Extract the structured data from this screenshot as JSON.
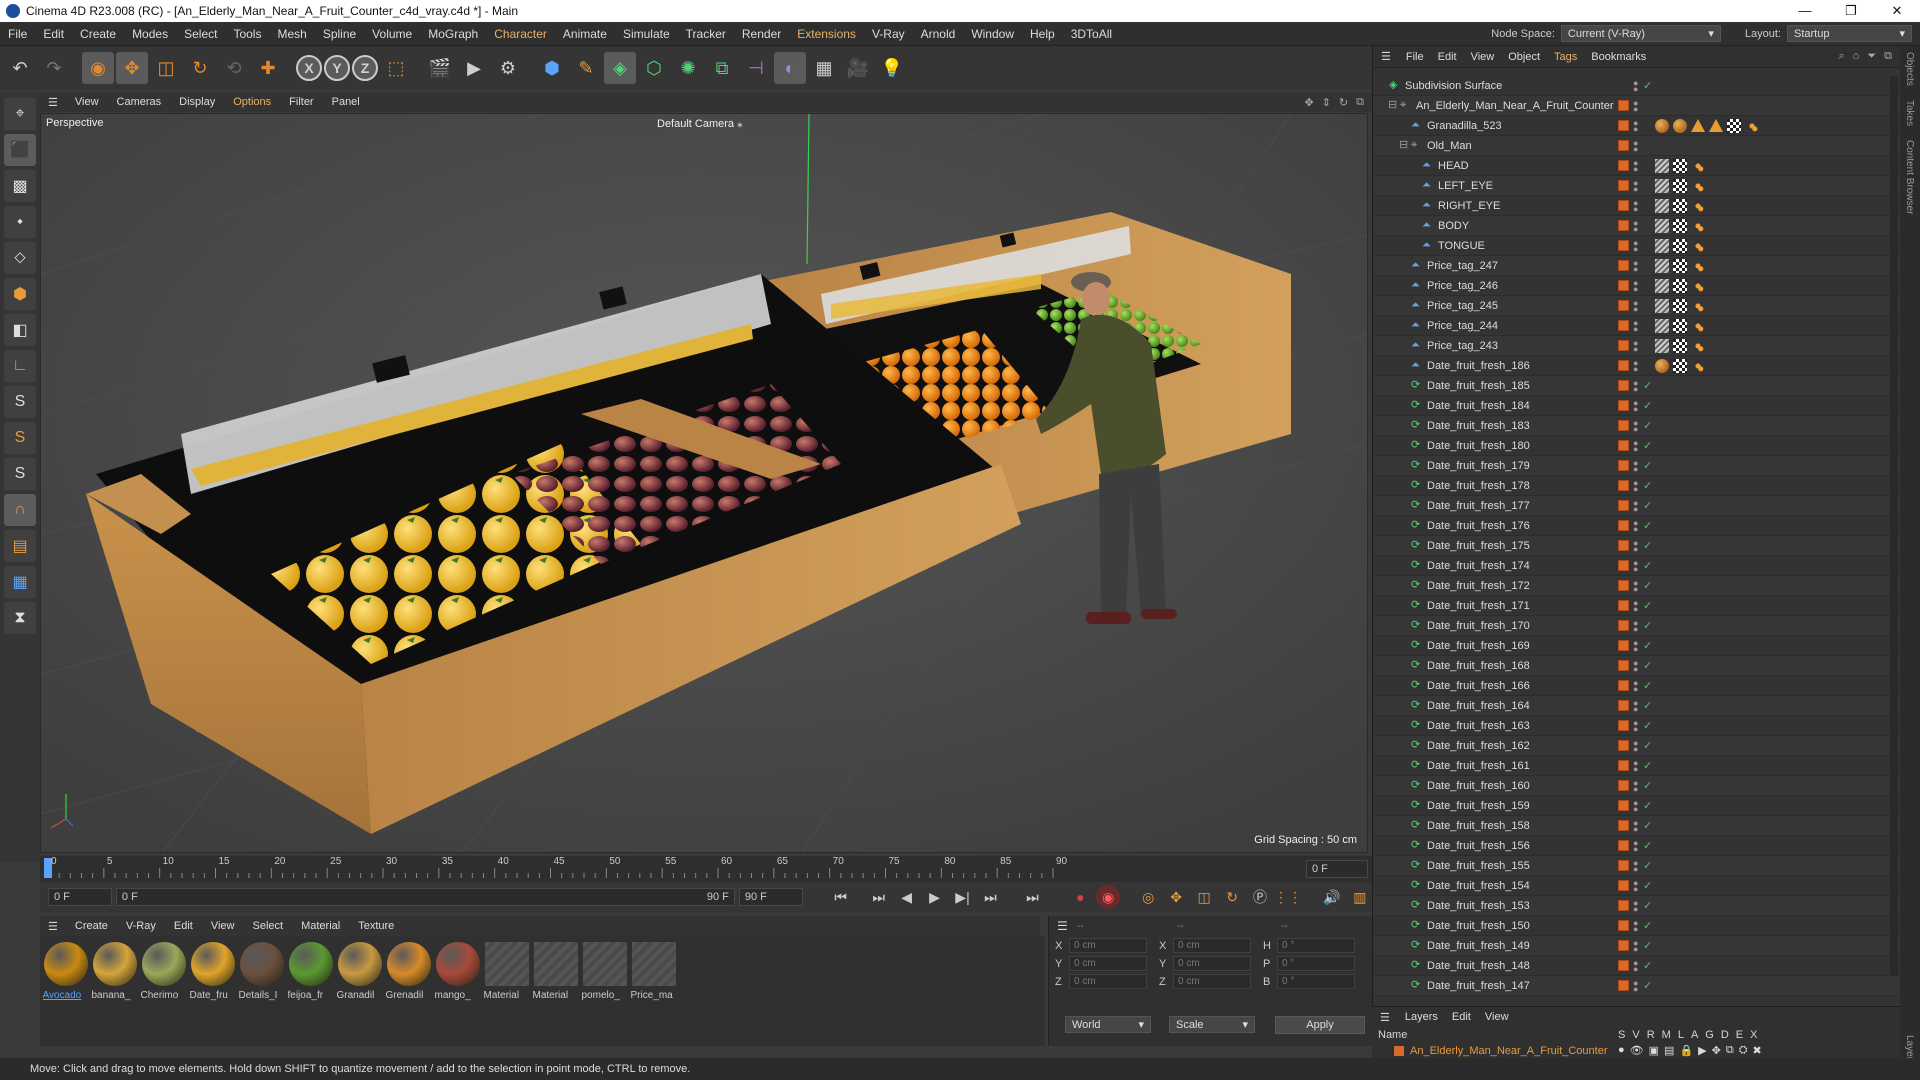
{
  "window": {
    "title": "Cinema 4D R23.008 (RC) - [An_Elderly_Man_Near_A_Fruit_Counter_c4d_vray.c4d *] - Main"
  },
  "menu": [
    "File",
    "Edit",
    "Create",
    "Modes",
    "Select",
    "Tools",
    "Mesh",
    "Spline",
    "Volume",
    "MoGraph",
    "Character",
    "Animate",
    "Simulate",
    "Tracker",
    "Render",
    "Extensions",
    "V-Ray",
    "Arnold",
    "Window",
    "Help",
    "3DToAll"
  ],
  "menu_highlight": [
    "Character",
    "Extensions"
  ],
  "nodespace": {
    "label": "Node Space:",
    "value": "Current (V-Ray)"
  },
  "layout": {
    "label": "Layout:",
    "value": "Startup"
  },
  "toolbar_axes": [
    "X",
    "Y",
    "Z"
  ],
  "left_tools": [
    "S",
    "S",
    "S"
  ],
  "viewport_menu": [
    "View",
    "Cameras",
    "Display",
    "Options",
    "Filter",
    "Panel"
  ],
  "viewport": {
    "label": "Perspective",
    "camera": "Default Camera",
    "grid": "Grid Spacing : 50 cm"
  },
  "timeline": {
    "ticks": [
      "0",
      "5",
      "10",
      "15",
      "20",
      "25",
      "30",
      "35",
      "40",
      "45",
      "50",
      "55",
      "60",
      "65",
      "70",
      "75",
      "80",
      "85",
      "90"
    ],
    "frame_field": "0 F"
  },
  "transport": {
    "start": "0 F",
    "cur": "0 F",
    "end": "90 F",
    "end2": "90 F"
  },
  "material_menu": [
    "Create",
    "V-Ray",
    "Edit",
    "View",
    "Select",
    "Material",
    "Texture"
  ],
  "materials": [
    {
      "name": "Avocado",
      "color": "#c98a12",
      "selected": true
    },
    {
      "name": "banana_",
      "color": "#d4a53a",
      "selected": false
    },
    {
      "name": "Cherimo",
      "color": "#9aa85a",
      "selected": false
    },
    {
      "name": "Date_fru",
      "color": "#e0a52a",
      "selected": false
    },
    {
      "name": "Details_I",
      "color": "#6a5040",
      "selected": false
    },
    {
      "name": "feijoa_fr",
      "color": "#5a9a32",
      "selected": false
    },
    {
      "name": "Granadil",
      "color": "#c89a40",
      "selected": false
    },
    {
      "name": "Grenadil",
      "color": "#d88a2a",
      "selected": false
    },
    {
      "name": "mango_",
      "color": "#a84a3a",
      "selected": false
    },
    {
      "name": "Material",
      "color": "",
      "selected": false
    },
    {
      "name": "Material",
      "color": "",
      "selected": false
    },
    {
      "name": "pomelo_",
      "color": "",
      "selected": false
    },
    {
      "name": "Price_ma",
      "color": "",
      "selected": false
    }
  ],
  "coords": {
    "header": "--",
    "rows": [
      {
        "a": "X",
        "v1": "0 cm",
        "b": "X",
        "v2": "0 cm",
        "c": "H",
        "v3": "0 °"
      },
      {
        "a": "Y",
        "v1": "0 cm",
        "b": "Y",
        "v2": "0 cm",
        "c": "P",
        "v3": "0 °"
      },
      {
        "a": "Z",
        "v1": "0 cm",
        "b": "Z",
        "v2": "0 cm",
        "c": "B",
        "v3": "0 °"
      }
    ],
    "world": "World",
    "scale": "Scale",
    "apply": "Apply"
  },
  "status": "Move: Click and drag to move elements. Hold down SHIFT to quantize movement / add to the selection in point mode, CTRL to remove.",
  "objects_menu": [
    "File",
    "Edit",
    "View",
    "Object",
    "Tags",
    "Bookmarks"
  ],
  "objects": [
    {
      "name": "Subdivision Surface",
      "indent": 0,
      "kind": "subd",
      "tags": []
    },
    {
      "name": "An_Elderly_Man_Near_A_Fruit_Counter",
      "indent": 1,
      "kind": "null",
      "tags": []
    },
    {
      "name": "Granadilla_523",
      "indent": 2,
      "kind": "bone",
      "tags": [
        "b",
        "b",
        "t",
        "t",
        "c",
        "o"
      ]
    },
    {
      "name": "Old_Man",
      "indent": 2,
      "kind": "null",
      "tags": []
    },
    {
      "name": "HEAD",
      "indent": 3,
      "kind": "bone",
      "tags": [
        "g",
        "c",
        "o"
      ]
    },
    {
      "name": "LEFT_EYE",
      "indent": 3,
      "kind": "bone",
      "tags": [
        "g",
        "c",
        "o"
      ]
    },
    {
      "name": "RIGHT_EYE",
      "indent": 3,
      "kind": "bone",
      "tags": [
        "g",
        "c",
        "o"
      ]
    },
    {
      "name": "BODY",
      "indent": 3,
      "kind": "bone",
      "tags": [
        "g",
        "c",
        "o"
      ]
    },
    {
      "name": "TONGUE",
      "indent": 3,
      "kind": "bone",
      "tags": [
        "g",
        "c",
        "o"
      ]
    },
    {
      "name": "Price_tag_247",
      "indent": 2,
      "kind": "bone",
      "tags": [
        "g",
        "c",
        "o"
      ]
    },
    {
      "name": "Price_tag_246",
      "indent": 2,
      "kind": "bone",
      "tags": [
        "g",
        "c",
        "o"
      ]
    },
    {
      "name": "Price_tag_245",
      "indent": 2,
      "kind": "bone",
      "tags": [
        "g",
        "c",
        "o"
      ]
    },
    {
      "name": "Price_tag_244",
      "indent": 2,
      "kind": "bone",
      "tags": [
        "g",
        "c",
        "o"
      ]
    },
    {
      "name": "Price_tag_243",
      "indent": 2,
      "kind": "bone",
      "tags": [
        "g",
        "c",
        "o"
      ]
    },
    {
      "name": "Date_fruit_fresh_186",
      "indent": 2,
      "kind": "bone",
      "tags": [
        "b",
        "c",
        "o"
      ]
    },
    {
      "name": "Date_fruit_fresh_185",
      "indent": 2,
      "kind": "inst",
      "tags": []
    },
    {
      "name": "Date_fruit_fresh_184",
      "indent": 2,
      "kind": "inst",
      "tags": []
    },
    {
      "name": "Date_fruit_fresh_183",
      "indent": 2,
      "kind": "inst",
      "tags": []
    },
    {
      "name": "Date_fruit_fresh_180",
      "indent": 2,
      "kind": "inst",
      "tags": []
    },
    {
      "name": "Date_fruit_fresh_179",
      "indent": 2,
      "kind": "inst",
      "tags": []
    },
    {
      "name": "Date_fruit_fresh_178",
      "indent": 2,
      "kind": "inst",
      "tags": []
    },
    {
      "name": "Date_fruit_fresh_177",
      "indent": 2,
      "kind": "inst",
      "tags": []
    },
    {
      "name": "Date_fruit_fresh_176",
      "indent": 2,
      "kind": "inst",
      "tags": []
    },
    {
      "name": "Date_fruit_fresh_175",
      "indent": 2,
      "kind": "inst",
      "tags": []
    },
    {
      "name": "Date_fruit_fresh_174",
      "indent": 2,
      "kind": "inst",
      "tags": []
    },
    {
      "name": "Date_fruit_fresh_172",
      "indent": 2,
      "kind": "inst",
      "tags": []
    },
    {
      "name": "Date_fruit_fresh_171",
      "indent": 2,
      "kind": "inst",
      "tags": []
    },
    {
      "name": "Date_fruit_fresh_170",
      "indent": 2,
      "kind": "inst",
      "tags": []
    },
    {
      "name": "Date_fruit_fresh_169",
      "indent": 2,
      "kind": "inst",
      "tags": []
    },
    {
      "name": "Date_fruit_fresh_168",
      "indent": 2,
      "kind": "inst",
      "tags": []
    },
    {
      "name": "Date_fruit_fresh_166",
      "indent": 2,
      "kind": "inst",
      "tags": []
    },
    {
      "name": "Date_fruit_fresh_164",
      "indent": 2,
      "kind": "inst",
      "tags": []
    },
    {
      "name": "Date_fruit_fresh_163",
      "indent": 2,
      "kind": "inst",
      "tags": []
    },
    {
      "name": "Date_fruit_fresh_162",
      "indent": 2,
      "kind": "inst",
      "tags": []
    },
    {
      "name": "Date_fruit_fresh_161",
      "indent": 2,
      "kind": "inst",
      "tags": []
    },
    {
      "name": "Date_fruit_fresh_160",
      "indent": 2,
      "kind": "inst",
      "tags": []
    },
    {
      "name": "Date_fruit_fresh_159",
      "indent": 2,
      "kind": "inst",
      "tags": []
    },
    {
      "name": "Date_fruit_fresh_158",
      "indent": 2,
      "kind": "inst",
      "tags": []
    },
    {
      "name": "Date_fruit_fresh_156",
      "indent": 2,
      "kind": "inst",
      "tags": []
    },
    {
      "name": "Date_fruit_fresh_155",
      "indent": 2,
      "kind": "inst",
      "tags": []
    },
    {
      "name": "Date_fruit_fresh_154",
      "indent": 2,
      "kind": "inst",
      "tags": []
    },
    {
      "name": "Date_fruit_fresh_153",
      "indent": 2,
      "kind": "inst",
      "tags": []
    },
    {
      "name": "Date_fruit_fresh_150",
      "indent": 2,
      "kind": "inst",
      "tags": []
    },
    {
      "name": "Date_fruit_fresh_149",
      "indent": 2,
      "kind": "inst",
      "tags": []
    },
    {
      "name": "Date_fruit_fresh_148",
      "indent": 2,
      "kind": "inst",
      "tags": []
    },
    {
      "name": "Date_fruit_fresh_147",
      "indent": 2,
      "kind": "inst",
      "tags": []
    }
  ],
  "layers": {
    "menu": [
      "Layers",
      "Edit",
      "View"
    ],
    "col_name": "Name",
    "cols": [
      "S",
      "V",
      "R",
      "M",
      "L",
      "A",
      "G",
      "D",
      "E",
      "X"
    ],
    "item": "An_Elderly_Man_Near_A_Fruit_Counter"
  },
  "side_tabs": [
    "Objects",
    "Takes",
    "Content Browser",
    "Layers"
  ],
  "colors": {
    "accent": "#e8b26a",
    "layer": "#d96a2a",
    "check": "#46d246",
    "select_blue": "#5aa3ff"
  }
}
